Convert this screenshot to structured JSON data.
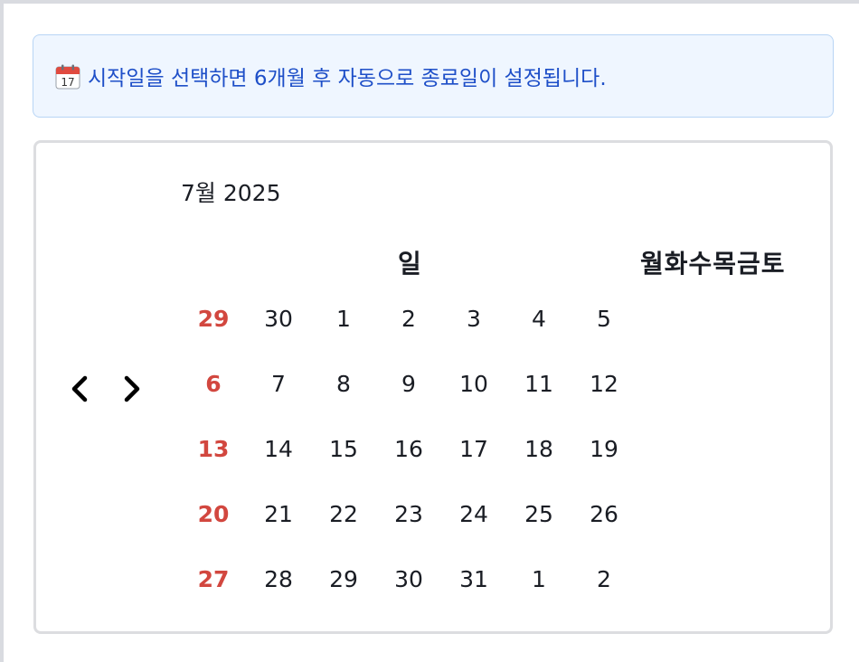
{
  "notice": {
    "icon": "calendar-icon",
    "text": "시작일을 선택하면 6개월 후 자동으로 종료일이 설정됩니다."
  },
  "calendar": {
    "month_label": "7월 2025",
    "weekday_sun": "일",
    "weekday_rest": "월화수목금토",
    "prev_icon": "chevron-left-icon",
    "next_icon": "chevron-right-icon",
    "weeks": [
      [
        "29",
        "30",
        "1",
        "2",
        "3",
        "4",
        "5"
      ],
      [
        "6",
        "7",
        "8",
        "9",
        "10",
        "11",
        "12"
      ],
      [
        "13",
        "14",
        "15",
        "16",
        "17",
        "18",
        "19"
      ],
      [
        "20",
        "21",
        "22",
        "23",
        "24",
        "25",
        "26"
      ],
      [
        "27",
        "28",
        "29",
        "30",
        "31",
        "1",
        "2"
      ]
    ]
  },
  "colors": {
    "sunday": "#d2473f",
    "notice_text": "#1e4fc8",
    "notice_bg": "#eff6ff"
  }
}
